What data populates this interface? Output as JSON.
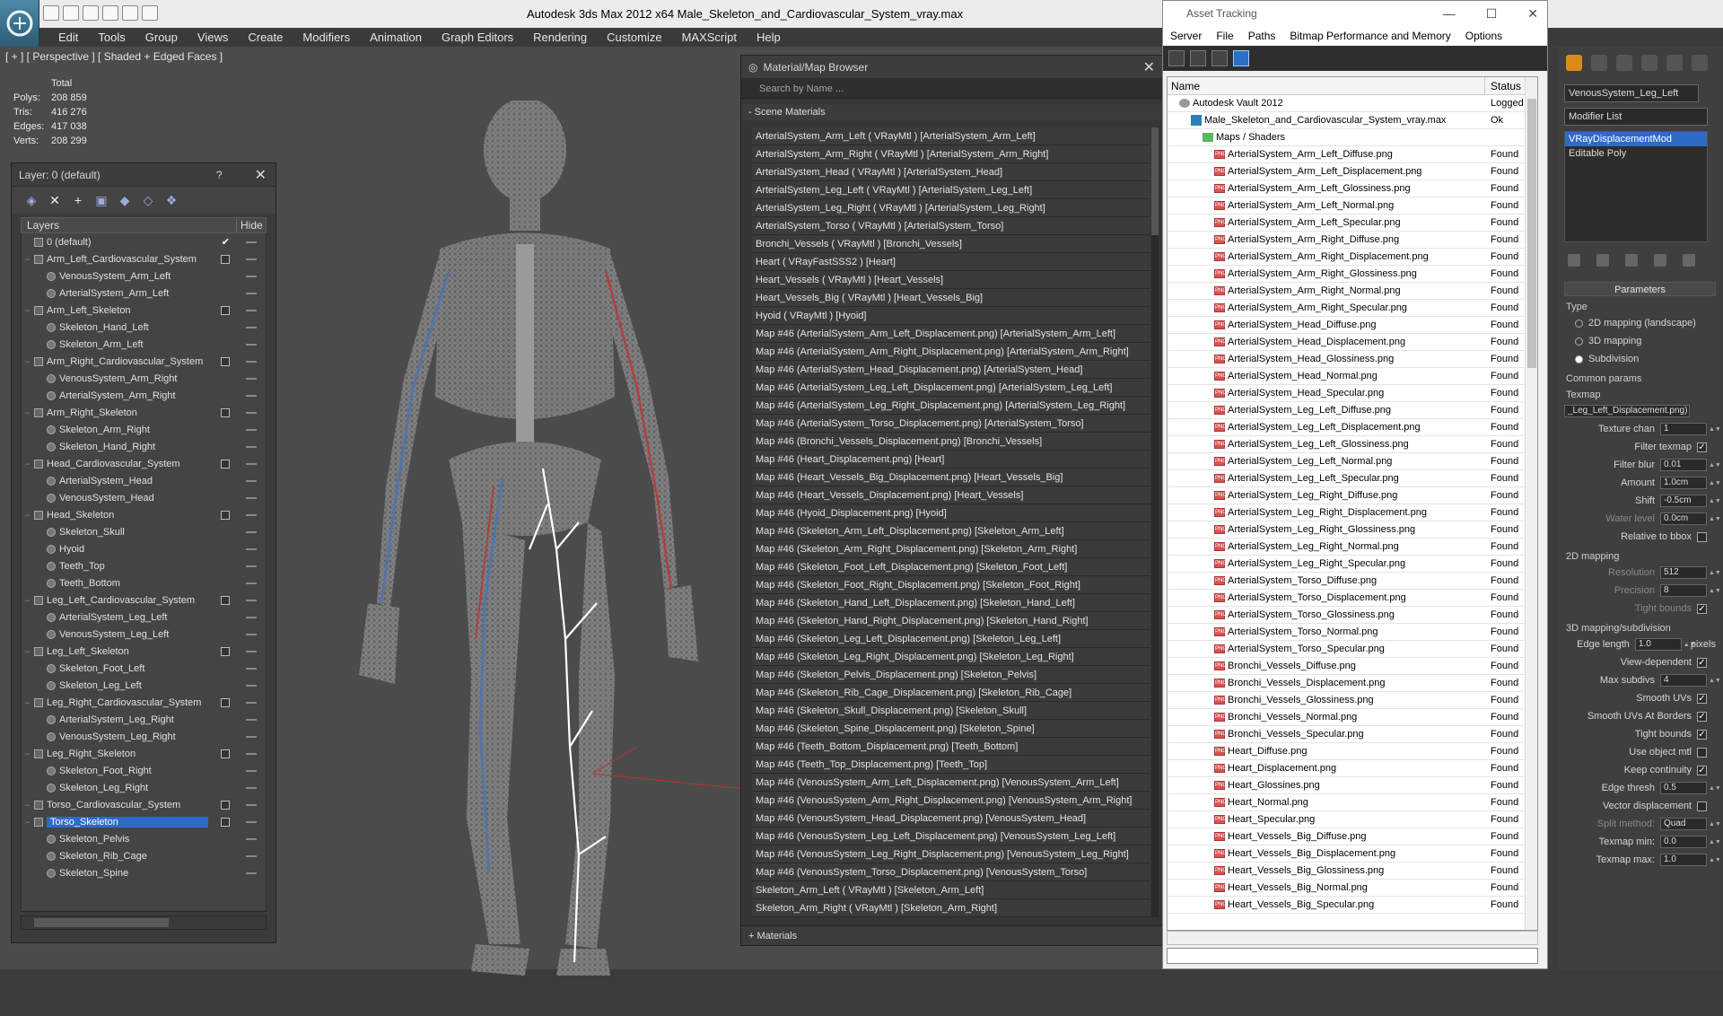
{
  "window": {
    "title": "Autodesk 3ds Max  2012 x64      Male_Skeleton_and_Cardiovascular_System_vray.max"
  },
  "menu": [
    "Edit",
    "Tools",
    "Group",
    "Views",
    "Create",
    "Modifiers",
    "Animation",
    "Graph Editors",
    "Rendering",
    "Customize",
    "MAXScript",
    "Help"
  ],
  "viewport": {
    "label": "[ + ] [ Perspective ] [ Shaded + Edged Faces ]",
    "stats": {
      "header": "Total",
      "rows": [
        {
          "k": "Polys:",
          "v": "208 859"
        },
        {
          "k": "Tris:",
          "v": "416 276"
        },
        {
          "k": "Edges:",
          "v": "417 038"
        },
        {
          "k": "Verts:",
          "v": "208 299"
        }
      ]
    }
  },
  "layer_panel": {
    "title": "Layer: 0 (default)",
    "help": "?",
    "columns": {
      "layers": "Layers",
      "hide": "Hide"
    },
    "rows": [
      {
        "label": "0 (default)",
        "level": 0,
        "type": "layer",
        "check": true
      },
      {
        "label": "Arm_Left_Cardiovascular_System",
        "level": 0,
        "type": "layer"
      },
      {
        "label": "VenousSystem_Arm_Left",
        "level": 1,
        "type": "obj"
      },
      {
        "label": "ArterialSystem_Arm_Left",
        "level": 1,
        "type": "obj"
      },
      {
        "label": "Arm_Left_Skeleton",
        "level": 0,
        "type": "layer"
      },
      {
        "label": "Skeleton_Hand_Left",
        "level": 1,
        "type": "obj"
      },
      {
        "label": "Skeleton_Arm_Left",
        "level": 1,
        "type": "obj"
      },
      {
        "label": "Arm_Right_Cardiovascular_System",
        "level": 0,
        "type": "layer"
      },
      {
        "label": "VenousSystem_Arm_Right",
        "level": 1,
        "type": "obj"
      },
      {
        "label": "ArterialSystem_Arm_Right",
        "level": 1,
        "type": "obj"
      },
      {
        "label": "Arm_Right_Skeleton",
        "level": 0,
        "type": "layer"
      },
      {
        "label": "Skeleton_Arm_Right",
        "level": 1,
        "type": "obj"
      },
      {
        "label": "Skeleton_Hand_Right",
        "level": 1,
        "type": "obj"
      },
      {
        "label": "Head_Cardiovascular_System",
        "level": 0,
        "type": "layer"
      },
      {
        "label": "ArterialSystem_Head",
        "level": 1,
        "type": "obj"
      },
      {
        "label": "VenousSystem_Head",
        "level": 1,
        "type": "obj"
      },
      {
        "label": "Head_Skeleton",
        "level": 0,
        "type": "layer"
      },
      {
        "label": "Skeleton_Skull",
        "level": 1,
        "type": "obj"
      },
      {
        "label": "Hyoid",
        "level": 1,
        "type": "obj"
      },
      {
        "label": "Teeth_Top",
        "level": 1,
        "type": "obj"
      },
      {
        "label": "Teeth_Bottom",
        "level": 1,
        "type": "obj"
      },
      {
        "label": "Leg_Left_Cardiovascular_System",
        "level": 0,
        "type": "layer"
      },
      {
        "label": "ArterialSystem_Leg_Left",
        "level": 1,
        "type": "obj"
      },
      {
        "label": "VenousSystem_Leg_Left",
        "level": 1,
        "type": "obj"
      },
      {
        "label": "Leg_Left_Skeleton",
        "level": 0,
        "type": "layer"
      },
      {
        "label": "Skeleton_Foot_Left",
        "level": 1,
        "type": "obj"
      },
      {
        "label": "Skeleton_Leg_Left",
        "level": 1,
        "type": "obj"
      },
      {
        "label": "Leg_Right_Cardiovascular_System",
        "level": 0,
        "type": "layer"
      },
      {
        "label": "ArterialSystem_Leg_Right",
        "level": 1,
        "type": "obj"
      },
      {
        "label": "VenousSystem_Leg_Right",
        "level": 1,
        "type": "obj"
      },
      {
        "label": "Leg_Right_Skeleton",
        "level": 0,
        "type": "layer"
      },
      {
        "label": "Skeleton_Foot_Right",
        "level": 1,
        "type": "obj"
      },
      {
        "label": "Skeleton_Leg_Right",
        "level": 1,
        "type": "obj"
      },
      {
        "label": "Torso_Cardiovascular_System",
        "level": 0,
        "type": "layer"
      },
      {
        "label": "Torso_Skeleton",
        "level": 0,
        "type": "layer",
        "selected": true
      },
      {
        "label": "Skeleton_Pelvis",
        "level": 1,
        "type": "obj"
      },
      {
        "label": "Skeleton_Rib_Cage",
        "level": 1,
        "type": "obj"
      },
      {
        "label": "Skeleton_Spine",
        "level": 1,
        "type": "obj"
      }
    ]
  },
  "material_browser": {
    "title": "Material/Map Browser",
    "search_placeholder": "Search by Name ...",
    "section": "- Scene Materials",
    "footer": "+ Materials",
    "items": [
      "ArterialSystem_Arm_Left  ( VRayMtl ) [ArterialSystem_Arm_Left]",
      "ArterialSystem_Arm_Right  ( VRayMtl ) [ArterialSystem_Arm_Right]",
      "ArterialSystem_Head  ( VRayMtl ) [ArterialSystem_Head]",
      "ArterialSystem_Leg_Left  ( VRayMtl ) [ArterialSystem_Leg_Left]",
      "ArterialSystem_Leg_Right  ( VRayMtl ) [ArterialSystem_Leg_Right]",
      "ArterialSystem_Torso  ( VRayMtl ) [ArterialSystem_Torso]",
      "Bronchi_Vessels  ( VRayMtl ) [Bronchi_Vessels]",
      "Heart  ( VRayFastSSS2 ) [Heart]",
      "Heart_Vessels  ( VRayMtl ) [Heart_Vessels]",
      "Heart_Vessels_Big  ( VRayMtl ) [Heart_Vessels_Big]",
      "Hyoid  ( VRayMtl ) [Hyoid]",
      "Map #46 (ArterialSystem_Arm_Left_Displacement.png) [ArterialSystem_Arm_Left]",
      "Map #46 (ArterialSystem_Arm_Right_Displacement.png) [ArterialSystem_Arm_Right]",
      "Map #46 (ArterialSystem_Head_Displacement.png) [ArterialSystem_Head]",
      "Map #46 (ArterialSystem_Leg_Left_Displacement.png) [ArterialSystem_Leg_Left]",
      "Map #46 (ArterialSystem_Leg_Right_Displacement.png) [ArterialSystem_Leg_Right]",
      "Map #46 (ArterialSystem_Torso_Displacement.png) [ArterialSystem_Torso]",
      "Map #46 (Bronchi_Vessels_Displacement.png) [Bronchi_Vessels]",
      "Map #46 (Heart_Displacement.png) [Heart]",
      "Map #46 (Heart_Vessels_Big_Displacement.png) [Heart_Vessels_Big]",
      "Map #46 (Heart_Vessels_Displacement.png) [Heart_Vessels]",
      "Map #46 (Hyoid_Displacement.png) [Hyoid]",
      "Map #46 (Skeleton_Arm_Left_Displacement.png) [Skeleton_Arm_Left]",
      "Map #46 (Skeleton_Arm_Right_Displacement.png) [Skeleton_Arm_Right]",
      "Map #46 (Skeleton_Foot_Left_Displacement.png) [Skeleton_Foot_Left]",
      "Map #46 (Skeleton_Foot_Right_Displacement.png) [Skeleton_Foot_Right]",
      "Map #46 (Skeleton_Hand_Left_Displacement.png) [Skeleton_Hand_Left]",
      "Map #46 (Skeleton_Hand_Right_Displacement.png) [Skeleton_Hand_Right]",
      "Map #46 (Skeleton_Leg_Left_Displacement.png) [Skeleton_Leg_Left]",
      "Map #46 (Skeleton_Leg_Right_Displacement.png) [Skeleton_Leg_Right]",
      "Map #46 (Skeleton_Pelvis_Displacement.png) [Skeleton_Pelvis]",
      "Map #46 (Skeleton_Rib_Cage_Displacement.png) [Skeleton_Rib_Cage]",
      "Map #46 (Skeleton_Skull_Displacement.png) [Skeleton_Skull]",
      "Map #46 (Skeleton_Spine_Displacement.png) [Skeleton_Spine]",
      "Map #46 (Teeth_Bottom_Displacement.png) [Teeth_Bottom]",
      "Map #46 (Teeth_Top_Displacement.png) [Teeth_Top]",
      "Map #46 (VenousSystem_Arm_Left_Displacement.png) [VenousSystem_Arm_Left]",
      "Map #46 (VenousSystem_Arm_Right_Displacement.png) [VenousSystem_Arm_Right]",
      "Map #46 (VenousSystem_Head_Displacement.png) [VenousSystem_Head]",
      "Map #46 (VenousSystem_Leg_Left_Displacement.png) [VenousSystem_Leg_Left]",
      "Map #46 (VenousSystem_Leg_Right_Displacement.png) [VenousSystem_Leg_Right]",
      "Map #46 (VenousSystem_Torso_Displacement.png) [VenousSystem_Torso]",
      "Skeleton_Arm_Left  ( VRayMtl ) [Skeleton_Arm_Left]",
      "Skeleton_Arm_Right  ( VRayMtl ) [Skeleton_Arm_Right]"
    ]
  },
  "asset_tracking": {
    "title": "Asset Tracking",
    "menu": [
      "Server",
      "File",
      "Paths",
      "Bitmap Performance and Memory",
      "Options"
    ],
    "columns": {
      "name": "Name",
      "status": "Status"
    },
    "rows": [
      {
        "name": "Autodesk Vault 2012",
        "status": "Logged O",
        "kind": "vault",
        "level": 1
      },
      {
        "name": "Male_Skeleton_and_Cardiovascular_System_vray.max",
        "status": "Ok",
        "kind": "max",
        "level": 2
      },
      {
        "name": "Maps / Shaders",
        "status": "",
        "kind": "folder",
        "level": 3
      },
      {
        "name": "ArterialSystem_Arm_Left_Diffuse.png",
        "status": "Found",
        "kind": "png",
        "level": 4
      },
      {
        "name": "ArterialSystem_Arm_Left_Displacement.png",
        "status": "Found",
        "kind": "png",
        "level": 4
      },
      {
        "name": "ArterialSystem_Arm_Left_Glossiness.png",
        "status": "Found",
        "kind": "png",
        "level": 4
      },
      {
        "name": "ArterialSystem_Arm_Left_Normal.png",
        "status": "Found",
        "kind": "png",
        "level": 4
      },
      {
        "name": "ArterialSystem_Arm_Left_Specular.png",
        "status": "Found",
        "kind": "png",
        "level": 4
      },
      {
        "name": "ArterialSystem_Arm_Right_Diffuse.png",
        "status": "Found",
        "kind": "png",
        "level": 4
      },
      {
        "name": "ArterialSystem_Arm_Right_Displacement.png",
        "status": "Found",
        "kind": "png",
        "level": 4
      },
      {
        "name": "ArterialSystem_Arm_Right_Glossiness.png",
        "status": "Found",
        "kind": "png",
        "level": 4
      },
      {
        "name": "ArterialSystem_Arm_Right_Normal.png",
        "status": "Found",
        "kind": "png",
        "level": 4
      },
      {
        "name": "ArterialSystem_Arm_Right_Specular.png",
        "status": "Found",
        "kind": "png",
        "level": 4
      },
      {
        "name": "ArterialSystem_Head_Diffuse.png",
        "status": "Found",
        "kind": "png",
        "level": 4
      },
      {
        "name": "ArterialSystem_Head_Displacement.png",
        "status": "Found",
        "kind": "png",
        "level": 4
      },
      {
        "name": "ArterialSystem_Head_Glossiness.png",
        "status": "Found",
        "kind": "png",
        "level": 4
      },
      {
        "name": "ArterialSystem_Head_Normal.png",
        "status": "Found",
        "kind": "png",
        "level": 4
      },
      {
        "name": "ArterialSystem_Head_Specular.png",
        "status": "Found",
        "kind": "png",
        "level": 4
      },
      {
        "name": "ArterialSystem_Leg_Left_Diffuse.png",
        "status": "Found",
        "kind": "png",
        "level": 4
      },
      {
        "name": "ArterialSystem_Leg_Left_Displacement.png",
        "status": "Found",
        "kind": "png",
        "level": 4
      },
      {
        "name": "ArterialSystem_Leg_Left_Glossiness.png",
        "status": "Found",
        "kind": "png",
        "level": 4
      },
      {
        "name": "ArterialSystem_Leg_Left_Normal.png",
        "status": "Found",
        "kind": "png",
        "level": 4
      },
      {
        "name": "ArterialSystem_Leg_Left_Specular.png",
        "status": "Found",
        "kind": "png",
        "level": 4
      },
      {
        "name": "ArterialSystem_Leg_Right_Diffuse.png",
        "status": "Found",
        "kind": "png",
        "level": 4
      },
      {
        "name": "ArterialSystem_Leg_Right_Displacement.png",
        "status": "Found",
        "kind": "png",
        "level": 4
      },
      {
        "name": "ArterialSystem_Leg_Right_Glossiness.png",
        "status": "Found",
        "kind": "png",
        "level": 4
      },
      {
        "name": "ArterialSystem_Leg_Right_Normal.png",
        "status": "Found",
        "kind": "png",
        "level": 4
      },
      {
        "name": "ArterialSystem_Leg_Right_Specular.png",
        "status": "Found",
        "kind": "png",
        "level": 4
      },
      {
        "name": "ArterialSystem_Torso_Diffuse.png",
        "status": "Found",
        "kind": "png",
        "level": 4
      },
      {
        "name": "ArterialSystem_Torso_Displacement.png",
        "status": "Found",
        "kind": "png",
        "level": 4
      },
      {
        "name": "ArterialSystem_Torso_Glossiness.png",
        "status": "Found",
        "kind": "png",
        "level": 4
      },
      {
        "name": "ArterialSystem_Torso_Normal.png",
        "status": "Found",
        "kind": "png",
        "level": 4
      },
      {
        "name": "ArterialSystem_Torso_Specular.png",
        "status": "Found",
        "kind": "png",
        "level": 4
      },
      {
        "name": "Bronchi_Vessels_Diffuse.png",
        "status": "Found",
        "kind": "png",
        "level": 4
      },
      {
        "name": "Bronchi_Vessels_Displacement.png",
        "status": "Found",
        "kind": "png",
        "level": 4
      },
      {
        "name": "Bronchi_Vessels_Glossiness.png",
        "status": "Found",
        "kind": "png",
        "level": 4
      },
      {
        "name": "Bronchi_Vessels_Normal.png",
        "status": "Found",
        "kind": "png",
        "level": 4
      },
      {
        "name": "Bronchi_Vessels_Specular.png",
        "status": "Found",
        "kind": "png",
        "level": 4
      },
      {
        "name": "Heart_Diffuse.png",
        "status": "Found",
        "kind": "png",
        "level": 4
      },
      {
        "name": "Heart_Displacement.png",
        "status": "Found",
        "kind": "png",
        "level": 4
      },
      {
        "name": "Heart_Glossines.png",
        "status": "Found",
        "kind": "png",
        "level": 4
      },
      {
        "name": "Heart_Normal.png",
        "status": "Found",
        "kind": "png",
        "level": 4
      },
      {
        "name": "Heart_Specular.png",
        "status": "Found",
        "kind": "png",
        "level": 4
      },
      {
        "name": "Heart_Vessels_Big_Diffuse.png",
        "status": "Found",
        "kind": "png",
        "level": 4
      },
      {
        "name": "Heart_Vessels_Big_Displacement.png",
        "status": "Found",
        "kind": "png",
        "level": 4
      },
      {
        "name": "Heart_Vessels_Big_Glossiness.png",
        "status": "Found",
        "kind": "png",
        "level": 4
      },
      {
        "name": "Heart_Vessels_Big_Normal.png",
        "status": "Found",
        "kind": "png",
        "level": 4
      },
      {
        "name": "Heart_Vessels_Big_Specular.png",
        "status": "Found",
        "kind": "png",
        "level": 4
      }
    ]
  },
  "command_panel": {
    "object_name": "VenousSystem_Leg_Left",
    "modifier_list": "Modifier List",
    "stack": [
      {
        "label": "VRayDisplacementMod",
        "selected": true
      },
      {
        "label": "Editable Poly",
        "selected": false
      }
    ],
    "rollout": "Parameters",
    "type_label": "Type",
    "type_options": [
      {
        "label": "2D mapping (landscape)",
        "on": false
      },
      {
        "label": "3D mapping",
        "on": false
      },
      {
        "label": "Subdivision",
        "on": true
      }
    ],
    "common_label": "Common params",
    "texmap_label": "Texmap",
    "texmap_value": "_Leg_Left_Displacement.png)",
    "common_rows": [
      {
        "label": "Texture chan",
        "value": "1",
        "kind": "spin"
      },
      {
        "label": "Filter texmap",
        "value": "✓",
        "kind": "check"
      },
      {
        "label": "Filter blur",
        "value": "0.01",
        "kind": "spin"
      },
      {
        "label": "Amount",
        "value": "1.0cm",
        "kind": "spin"
      },
      {
        "label": "Shift",
        "value": "-0.5cm",
        "kind": "spin"
      },
      {
        "label": "Water level",
        "value": "0.0cm",
        "kind": "spin",
        "dis": true
      },
      {
        "label": "Relative to bbox",
        "value": "",
        "kind": "check"
      }
    ],
    "map2d_label": "2D mapping",
    "map2d_rows": [
      {
        "label": "Resolution",
        "value": "512",
        "kind": "spin",
        "dis": true
      },
      {
        "label": "Precision",
        "value": "8",
        "kind": "spin",
        "dis": true
      },
      {
        "label": "Tight bounds",
        "value": "✓",
        "kind": "check",
        "dis": true
      }
    ],
    "map3d_label": "3D mapping/subdivision",
    "map3d_rows": [
      {
        "label": "Edge length",
        "value": "1.0",
        "kind": "spin",
        "suffix": "pixels"
      },
      {
        "label": "View-dependent",
        "value": "✓",
        "kind": "check"
      },
      {
        "label": "Max subdivs",
        "value": "4",
        "kind": "spin"
      },
      {
        "label": "Smooth UVs",
        "value": "✓",
        "kind": "check"
      },
      {
        "label": "Smooth UVs At Borders",
        "value": "✓",
        "kind": "check"
      },
      {
        "label": "Tight bounds",
        "value": "✓",
        "kind": "check"
      },
      {
        "label": "Use object mtl",
        "value": "",
        "kind": "check"
      },
      {
        "label": "Keep continuity",
        "value": "✓",
        "kind": "check"
      },
      {
        "label": "Edge thresh",
        "value": "0.5",
        "kind": "spin"
      },
      {
        "label": "Vector displacement",
        "value": "",
        "kind": "check"
      },
      {
        "label": "Split method:",
        "value": "Quad",
        "kind": "select",
        "dis": true
      },
      {
        "label": "Texmap min:",
        "value": "0.0",
        "kind": "spin"
      },
      {
        "label": "Texmap max:",
        "value": "1.0",
        "kind": "spin"
      }
    ]
  }
}
